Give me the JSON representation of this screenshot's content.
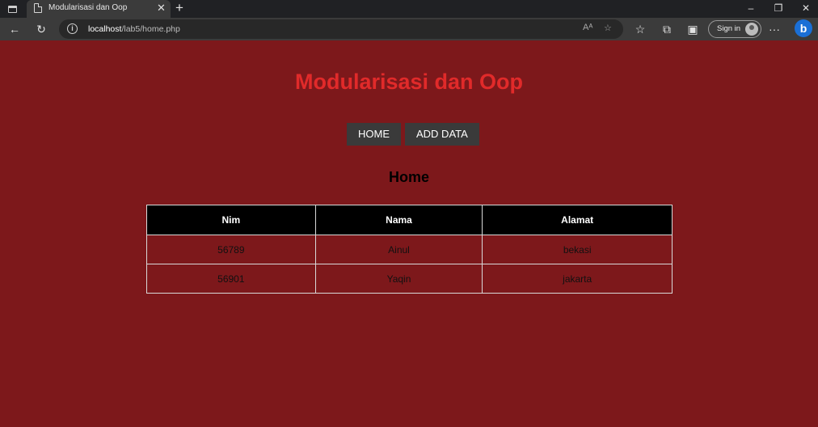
{
  "browser": {
    "tab_title": "Modularisasi dan Oop",
    "url_host": "localhost",
    "url_path": "/lab5/home.php",
    "sign_in_label": "Sign in"
  },
  "page": {
    "title": "Modularisasi dan Oop",
    "nav": [
      "HOME",
      "ADD DATA"
    ],
    "heading": "Home"
  },
  "table": {
    "headers": [
      "Nim",
      "Nama",
      "Alamat"
    ],
    "rows": [
      [
        "56789",
        "Ainul",
        "bekasi"
      ],
      [
        "56901",
        "Yaqin",
        "jakarta"
      ]
    ]
  },
  "colors": {
    "page_background": "#7d181b",
    "title_color": "#e12a2a",
    "nav_button": "#3a3a3a",
    "table_header": "#000000"
  },
  "icons": [
    "tab-actions-icon",
    "page-icon",
    "close-icon",
    "plus-icon",
    "back-icon",
    "refresh-icon",
    "info-icon",
    "read-aloud-icon",
    "add-favorite-icon",
    "favorites-icon",
    "collections-icon",
    "extensions-icon",
    "more-icon",
    "bing-icon"
  ]
}
